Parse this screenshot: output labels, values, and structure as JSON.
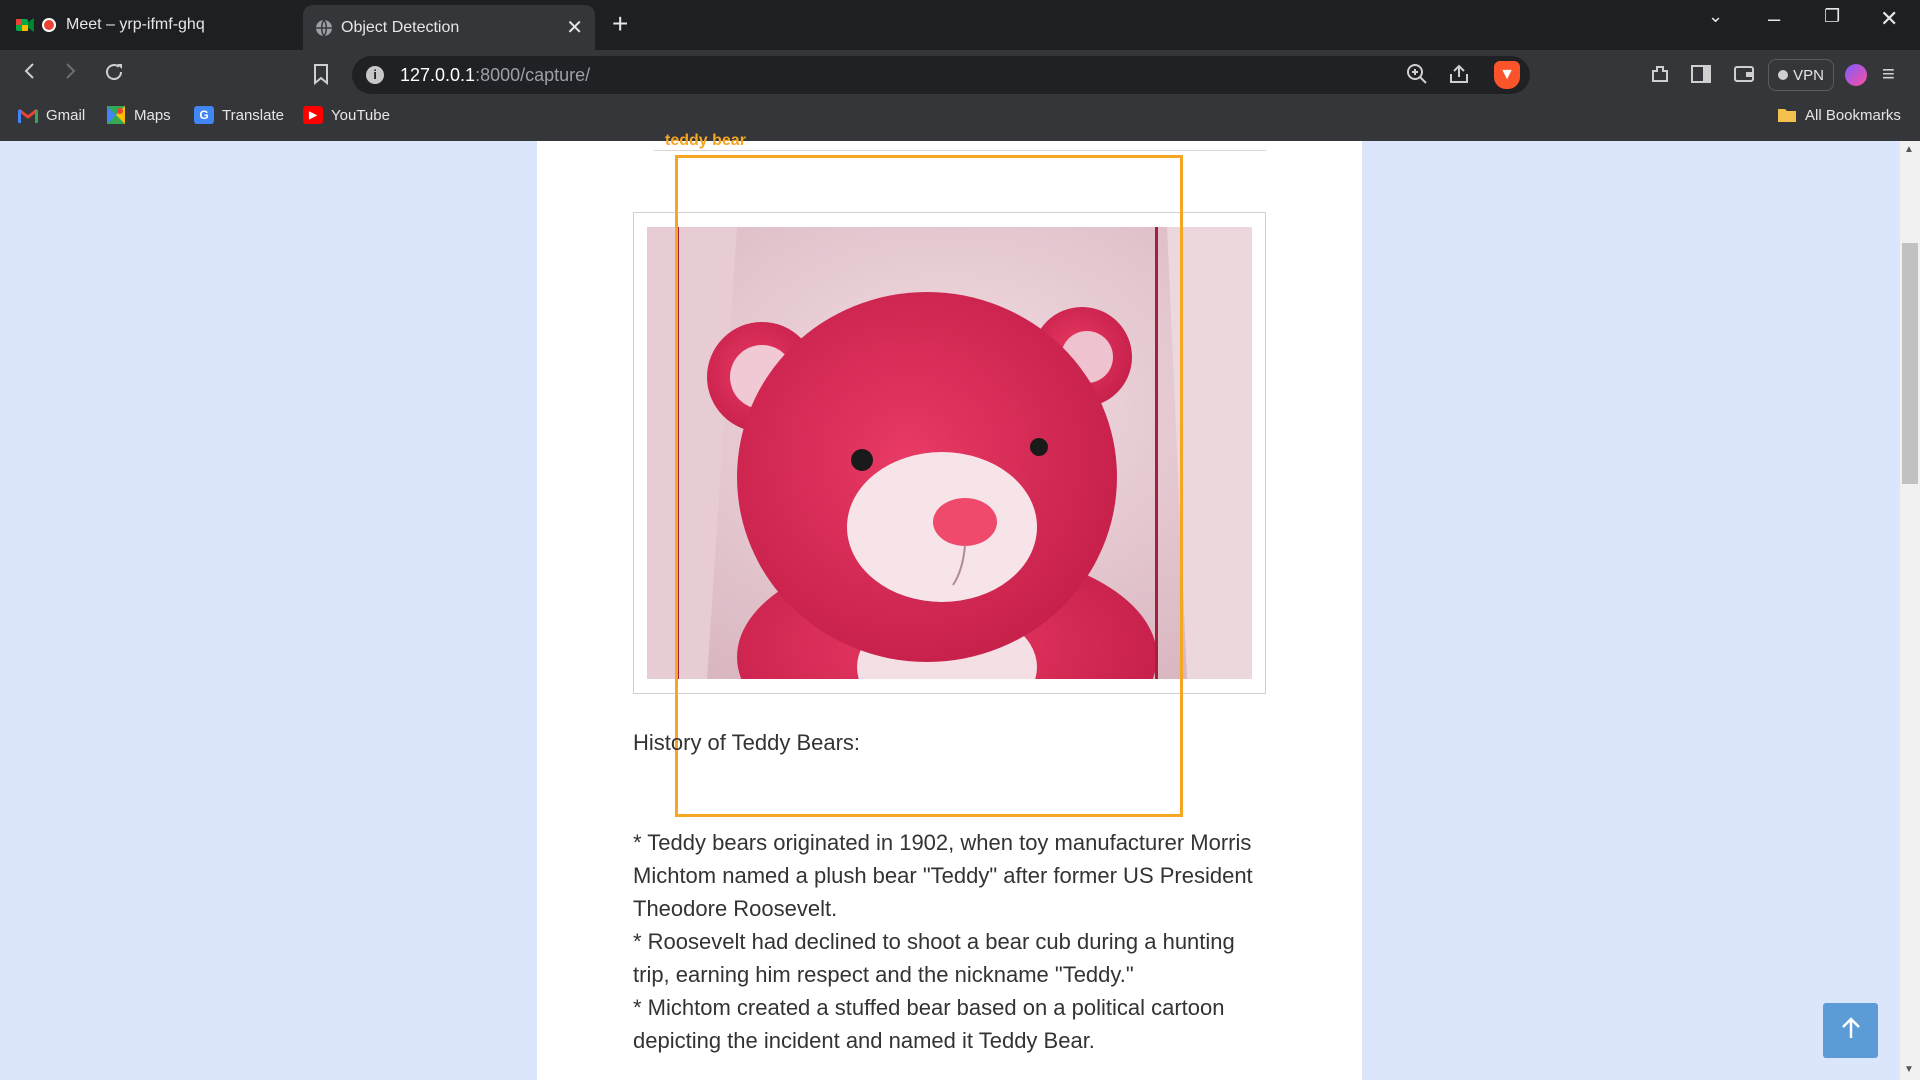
{
  "browser": {
    "tabs": [
      {
        "title": "Meet – yrp-ifmf-ghq",
        "active": false
      },
      {
        "title": "Object Detection",
        "active": true
      }
    ],
    "url": {
      "host": "127.0.0.1",
      "path": ":8000/capture/"
    },
    "vpn_label": "VPN",
    "bookmarks": [
      {
        "label": "Gmail",
        "icon": "gmail-icon"
      },
      {
        "label": "Maps",
        "icon": "maps-icon"
      },
      {
        "label": "Translate",
        "icon": "translate-icon"
      },
      {
        "label": "YouTube",
        "icon": "youtube-icon"
      }
    ],
    "all_bookmarks_label": "All Bookmarks"
  },
  "detection": {
    "label": "teddy bear",
    "box_color": "#f5a623"
  },
  "content": {
    "heading": "History of Teddy Bears:",
    "lines": [
      "* Teddy bears originated in 1902, when toy manufacturer Morris Michtom named a plush bear \"Teddy\" after former US President Theodore Roosevelt.",
      "* Roosevelt had declined to shoot a bear cub during a hunting trip, earning him respect and the nickname \"Teddy.\"",
      "* Michtom created a stuffed bear based on a political cartoon depicting the incident and named it Teddy Bear."
    ]
  },
  "colors": {
    "page_background": "#dbe5fb",
    "back_to_top": "#5b9cd6"
  }
}
